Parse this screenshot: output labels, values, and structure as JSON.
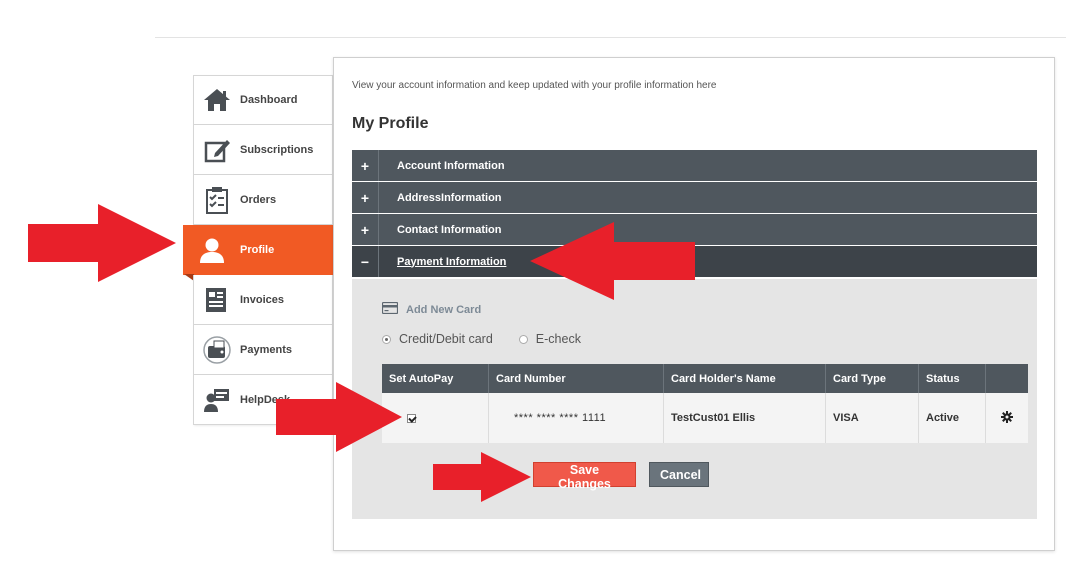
{
  "sidebar": {
    "items": [
      {
        "label": "Dashboard",
        "icon": "home-icon"
      },
      {
        "label": "Subscriptions",
        "icon": "edit-icon"
      },
      {
        "label": "Orders",
        "icon": "clipboard-icon"
      },
      {
        "label": "Profile",
        "icon": "user-icon",
        "active": true
      },
      {
        "label": "Invoices",
        "icon": "invoice-icon"
      },
      {
        "label": "Payments",
        "icon": "wallet-icon"
      },
      {
        "label": "HelpDesk",
        "icon": "support-icon"
      }
    ]
  },
  "main": {
    "intro": "View your account information and keep updated with your profile information here",
    "title": "My Profile",
    "sections": [
      {
        "sign": "+",
        "label": "Account Information"
      },
      {
        "sign": "+",
        "label": "AddressInformation"
      },
      {
        "sign": "+",
        "label": "Contact Information"
      },
      {
        "sign": "−",
        "label": "Payment Information",
        "open": true
      }
    ],
    "payment": {
      "add_card": "Add New Card",
      "methods": [
        {
          "label": "Credit/Debit card",
          "selected": true
        },
        {
          "label": "E-check",
          "selected": false
        }
      ],
      "table": {
        "headers": [
          "Set AutoPay",
          "Card Number",
          "Card Holder's Name",
          "Card Type",
          "Status",
          ""
        ],
        "rows": [
          {
            "autopay": true,
            "card_number": "**** **** **** 1111",
            "holder": "TestCust01 Ellis",
            "type": "VISA",
            "status": "Active"
          }
        ]
      },
      "save_label": "Save Changes",
      "cancel_label": "Cancel"
    }
  },
  "colors": {
    "accent": "#f15a24",
    "header_dark": "#4f575e",
    "save": "#f0594a",
    "cancel": "#6a747c",
    "annotation_arrow": "#e8202a"
  }
}
